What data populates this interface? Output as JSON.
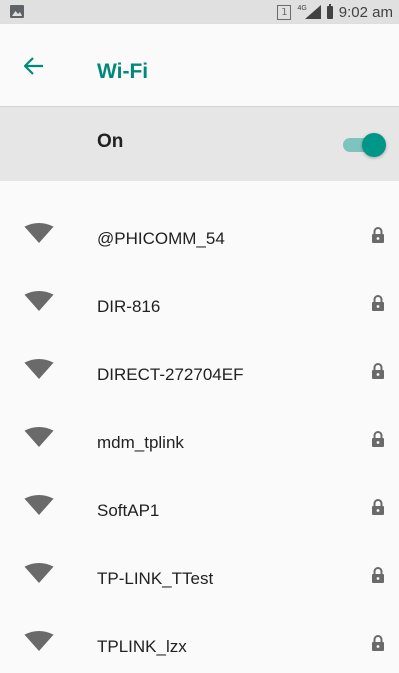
{
  "status_bar": {
    "sim_slot": "1",
    "network_type": "4G",
    "time": "9:02 am"
  },
  "app_bar": {
    "title": "Wi-Fi",
    "title_color": "#00897b"
  },
  "master_toggle": {
    "label": "On",
    "state": "on",
    "accent_color": "#009688"
  },
  "networks": [
    {
      "ssid": "@PHICOMM_54",
      "secured": true,
      "icon": "wifi-signal-icon"
    },
    {
      "ssid": "DIR-816",
      "secured": true,
      "icon": "wifi-signal-icon"
    },
    {
      "ssid": "DIRECT-272704EF",
      "secured": true,
      "icon": "wifi-signal-icon"
    },
    {
      "ssid": "mdm_tplink",
      "secured": true,
      "icon": "wifi-signal-icon"
    },
    {
      "ssid": "SoftAP1",
      "secured": true,
      "icon": "wifi-signal-icon"
    },
    {
      "ssid": "TP-LINK_TTest",
      "secured": true,
      "icon": "wifi-signal-icon"
    },
    {
      "ssid": "TPLINK_lzx",
      "secured": true,
      "icon": "wifi-signal-icon"
    }
  ]
}
